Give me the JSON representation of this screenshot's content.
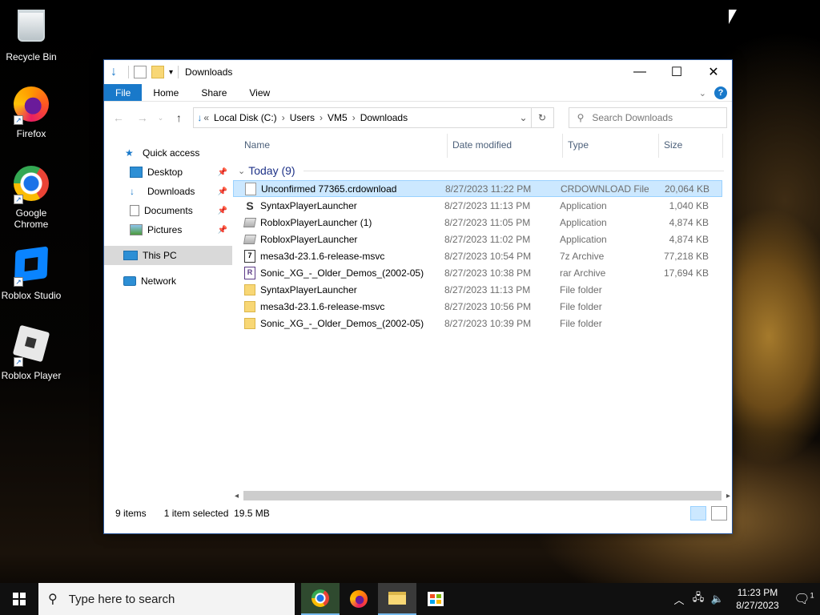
{
  "desktop": {
    "icons": [
      {
        "label": "Recycle Bin"
      },
      {
        "label": "Firefox"
      },
      {
        "label": "Google Chrome"
      },
      {
        "label": "Roblox Studio"
      },
      {
        "label": "Roblox Player"
      }
    ]
  },
  "window": {
    "title": "Downloads",
    "tabs": [
      "File",
      "Home",
      "Share",
      "View"
    ],
    "address": {
      "root_chevron": "«",
      "segments": [
        "Local Disk (C:)",
        "Users",
        "VM5",
        "Downloads"
      ]
    },
    "search_placeholder": "Search Downloads",
    "nav": [
      {
        "label": "Quick access",
        "icon": "star-icon"
      },
      {
        "label": "Desktop",
        "icon": "desktop-folder-icon",
        "pinned": true
      },
      {
        "label": "Downloads",
        "icon": "downloads-icon",
        "pinned": true
      },
      {
        "label": "Documents",
        "icon": "documents-icon",
        "pinned": true
      },
      {
        "label": "Pictures",
        "icon": "pictures-icon",
        "pinned": true
      },
      {
        "label": "This PC",
        "icon": "pc-icon",
        "selected": true
      },
      {
        "label": "Network",
        "icon": "network-icon"
      }
    ],
    "columns": [
      "Name",
      "Date modified",
      "Type",
      "Size"
    ],
    "group_label": "Today (9)",
    "files": [
      {
        "name": "Unconfirmed 77365.crdownload",
        "date": "8/27/2023 11:22 PM",
        "type": "CRDOWNLOAD File",
        "size": "20,064 KB",
        "icon": "doc",
        "selected": true
      },
      {
        "name": "SyntaxPlayerLauncher",
        "date": "8/27/2023 11:13 PM",
        "type": "Application",
        "size": "1,040 KB",
        "icon": "syn"
      },
      {
        "name": "RobloxPlayerLauncher (1)",
        "date": "8/27/2023 11:05 PM",
        "type": "Application",
        "size": "4,874 KB",
        "icon": "app"
      },
      {
        "name": "RobloxPlayerLauncher",
        "date": "8/27/2023 11:02 PM",
        "type": "Application",
        "size": "4,874 KB",
        "icon": "app"
      },
      {
        "name": "mesa3d-23.1.6-release-msvc",
        "date": "8/27/2023 10:54 PM",
        "type": "7z Archive",
        "size": "77,218 KB",
        "icon": "arc7"
      },
      {
        "name": "Sonic_XG_-_Older_Demos_(2002-05)",
        "date": "8/27/2023 10:38 PM",
        "type": "rar Archive",
        "size": "17,694 KB",
        "icon": "rar"
      },
      {
        "name": "SyntaxPlayerLauncher",
        "date": "8/27/2023 11:13 PM",
        "type": "File folder",
        "size": "",
        "icon": "folder"
      },
      {
        "name": "mesa3d-23.1.6-release-msvc",
        "date": "8/27/2023 10:56 PM",
        "type": "File folder",
        "size": "",
        "icon": "folder"
      },
      {
        "name": "Sonic_XG_-_Older_Demos_(2002-05)",
        "date": "8/27/2023 10:39 PM",
        "type": "File folder",
        "size": "",
        "icon": "folder"
      }
    ],
    "status": {
      "count": "9 items",
      "selected": "1 item selected",
      "size": "19.5 MB"
    }
  },
  "taskbar": {
    "search_placeholder": "Type here to search",
    "time": "11:23 PM",
    "date": "8/27/2023",
    "notification_count": "1"
  }
}
